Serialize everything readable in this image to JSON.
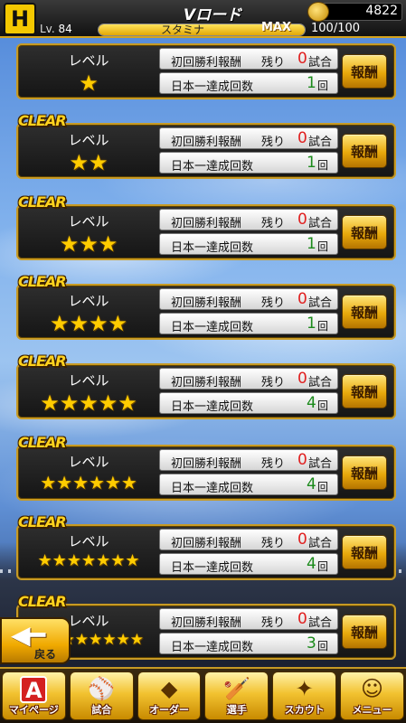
{
  "header": {
    "title": "Vロード",
    "level_label": "Lv.",
    "level_value": "84",
    "stamina_label": "スタミナ",
    "stamina_max_label": "MAX",
    "stamina_value": "100/100",
    "stamina_fraction": 1.0,
    "coins": "4822"
  },
  "levels": [
    {
      "clear": "",
      "level_label": "レベル",
      "stars": "★",
      "first_win_label": "初回勝利報酬",
      "remaining_label": "残り",
      "remaining_value": "0",
      "remaining_unit": "試合",
      "champion_label": "日本一達成回数",
      "champion_value": "1",
      "champion_unit": "回",
      "reward_label": "報酬"
    },
    {
      "clear": "CLEAR",
      "level_label": "レベル",
      "stars": "★★",
      "first_win_label": "初回勝利報酬",
      "remaining_label": "残り",
      "remaining_value": "0",
      "remaining_unit": "試合",
      "champion_label": "日本一達成回数",
      "champion_value": "1",
      "champion_unit": "回",
      "reward_label": "報酬"
    },
    {
      "clear": "CLEAR",
      "level_label": "レベル",
      "stars": "★★★",
      "first_win_label": "初回勝利報酬",
      "remaining_label": "残り",
      "remaining_value": "0",
      "remaining_unit": "試合",
      "champion_label": "日本一達成回数",
      "champion_value": "1",
      "champion_unit": "回",
      "reward_label": "報酬"
    },
    {
      "clear": "CLEAR",
      "level_label": "レベル",
      "stars": "★★★★",
      "first_win_label": "初回勝利報酬",
      "remaining_label": "残り",
      "remaining_value": "0",
      "remaining_unit": "試合",
      "champion_label": "日本一達成回数",
      "champion_value": "1",
      "champion_unit": "回",
      "reward_label": "報酬"
    },
    {
      "clear": "CLEAR",
      "level_label": "レベル",
      "stars": "★★★★★",
      "first_win_label": "初回勝利報酬",
      "remaining_label": "残り",
      "remaining_value": "0",
      "remaining_unit": "試合",
      "champion_label": "日本一達成回数",
      "champion_value": "4",
      "champion_unit": "回",
      "reward_label": "報酬"
    },
    {
      "clear": "CLEAR",
      "level_label": "レベル",
      "stars": "★★★★★★",
      "first_win_label": "初回勝利報酬",
      "remaining_label": "残り",
      "remaining_value": "0",
      "remaining_unit": "試合",
      "champion_label": "日本一達成回数",
      "champion_value": "4",
      "champion_unit": "回",
      "reward_label": "報酬"
    },
    {
      "clear": "CLEAR",
      "level_label": "レベル",
      "stars": "★★★★★★★",
      "first_win_label": "初回勝利報酬",
      "remaining_label": "残り",
      "remaining_value": "0",
      "remaining_unit": "試合",
      "champion_label": "日本一達成回数",
      "champion_value": "4",
      "champion_unit": "回",
      "reward_label": "報酬"
    },
    {
      "clear": "CLEAR",
      "level_label": "レベル",
      "stars": "★★★★★★★★",
      "first_win_label": "初回勝利報酬",
      "remaining_label": "残り",
      "remaining_value": "0",
      "remaining_unit": "試合",
      "champion_label": "日本一達成回数",
      "champion_value": "3",
      "champion_unit": "回",
      "reward_label": "報酬"
    }
  ],
  "back_button": {
    "label": "戻る"
  },
  "bottom_nav": [
    {
      "label": "マイページ",
      "icon": "mypage-icon",
      "glyph": "A"
    },
    {
      "label": "試合",
      "icon": "baseball-field-icon",
      "glyph": "⚾"
    },
    {
      "label": "オーダー",
      "icon": "order-field-icon",
      "glyph": "◆"
    },
    {
      "label": "選手",
      "icon": "batter-icon",
      "glyph": "🏏"
    },
    {
      "label": "スカウト",
      "icon": "scout-card-icon",
      "glyph": "✦"
    },
    {
      "label": "メニュー",
      "icon": "menu-character-icon",
      "glyph": "☺"
    }
  ],
  "colors": {
    "accent_gold": "#c79a24",
    "remaining_red": "#e02020",
    "count_green": "#1b8a1b",
    "clear_yellow": "#ffd21e"
  }
}
